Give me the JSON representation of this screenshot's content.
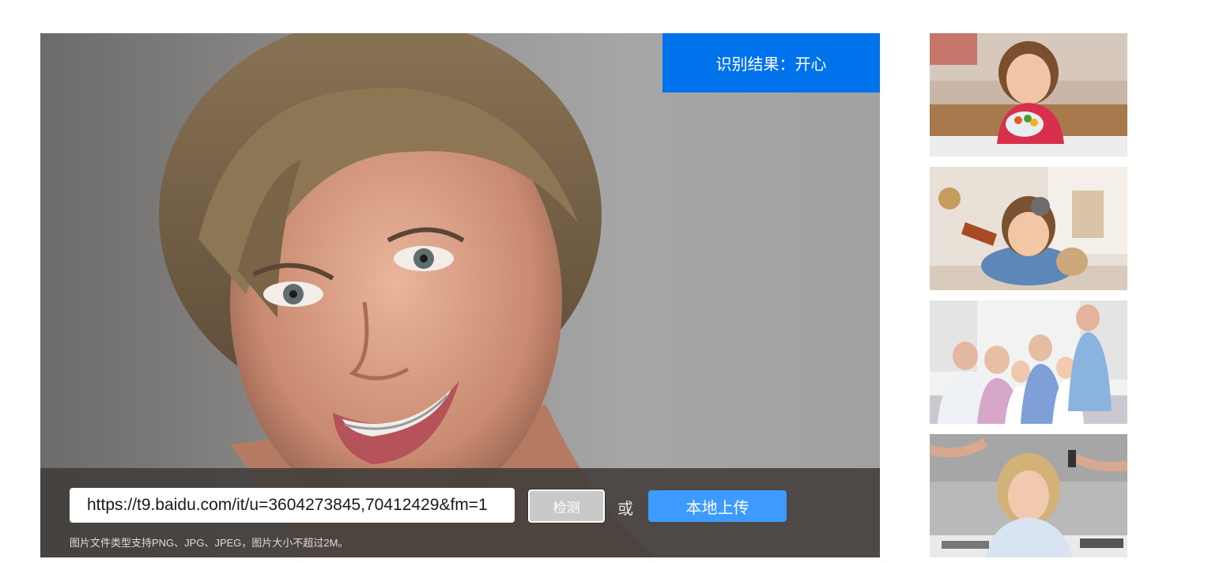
{
  "result": {
    "label": "识别结果：开心"
  },
  "upload": {
    "url_value": "https://t9.baidu.com/it/u=3604273845,70412429&fm=1",
    "detect_label": "检测",
    "or_label": "或",
    "local_upload_label": "本地上传",
    "hint": "图片文件类型支持PNG、JPG、JPEG，图片大小不超过2M。"
  },
  "colors": {
    "result_bg": "#0073ec",
    "upload_btn": "#3d9bff"
  }
}
